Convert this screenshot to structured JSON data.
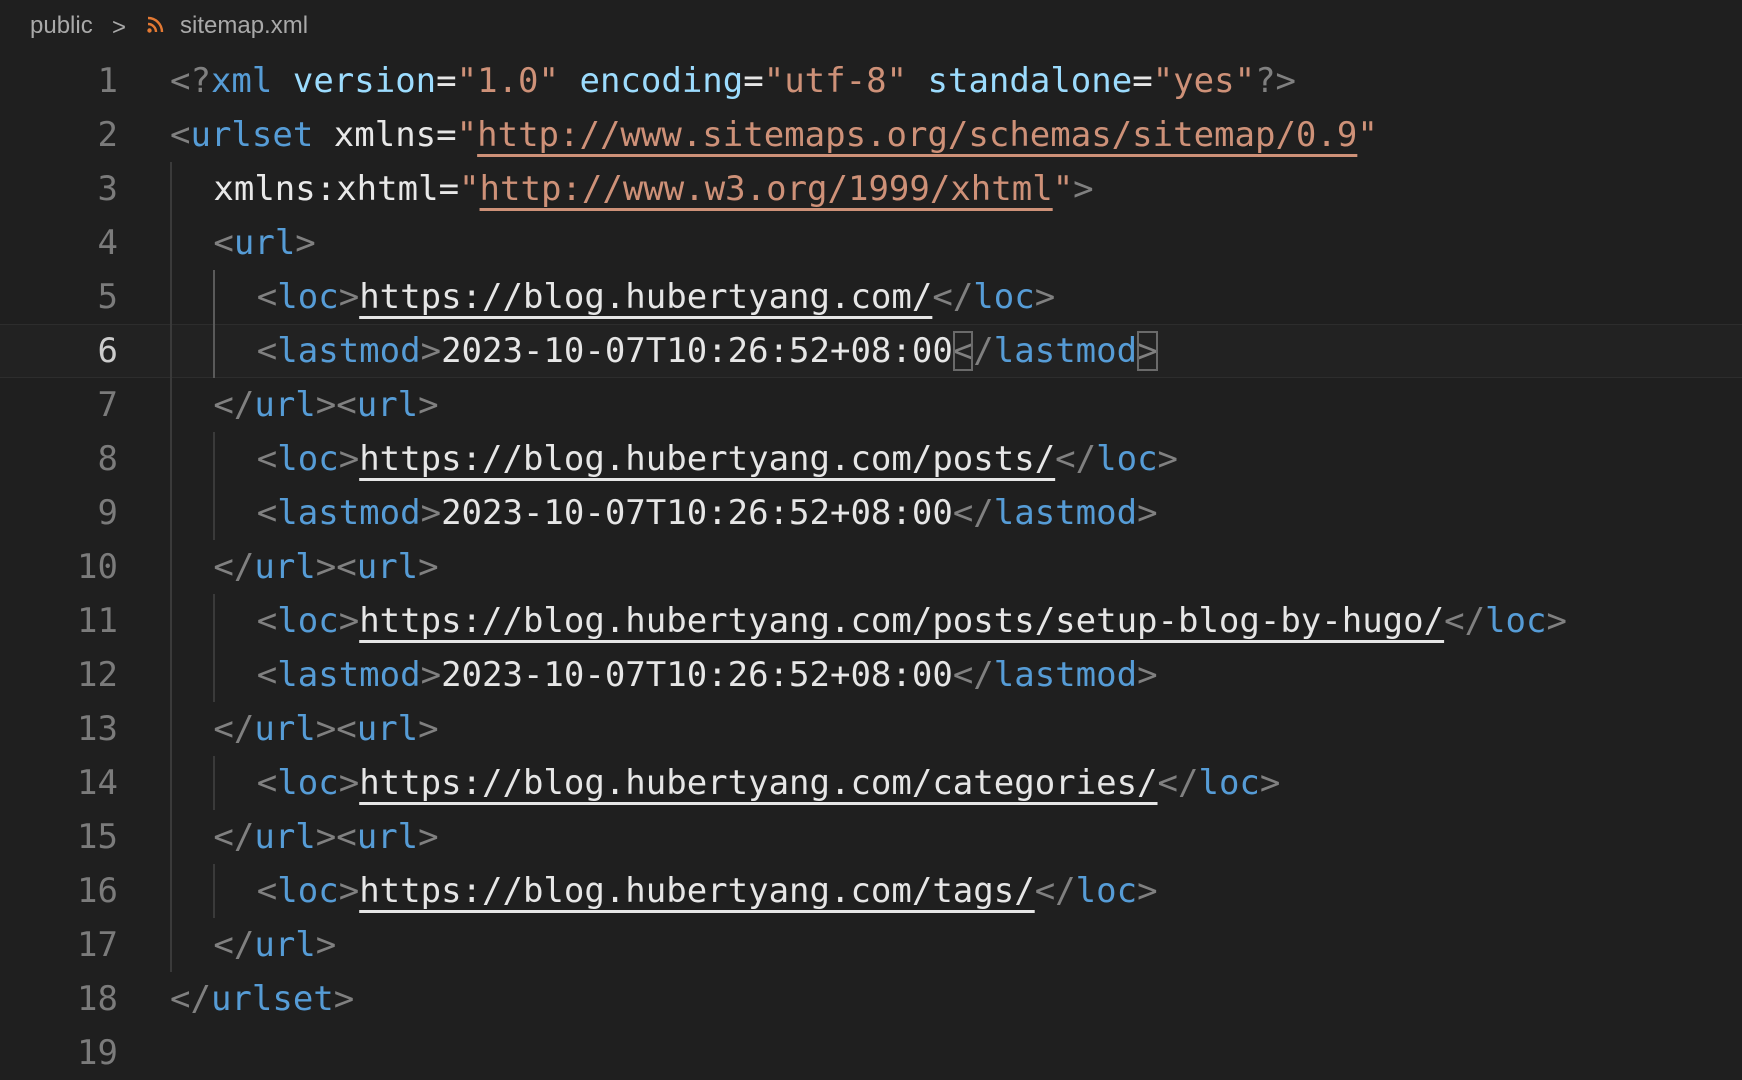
{
  "breadcrumb": {
    "folder": "public",
    "separator": ">",
    "file": "sitemap.xml",
    "file_icon": "rss-icon"
  },
  "colors": {
    "background": "#1f1f1f",
    "tag": "#569cd6",
    "attribute": "#9cdcfe",
    "string": "#ce9178",
    "punctuation": "#808080",
    "text": "#e6e6e6",
    "line_number": "#7b7b7b",
    "icon": "#e37933"
  },
  "editor": {
    "current_line": 6,
    "lines": [
      {
        "n": "1",
        "indent": 0,
        "tokens": [
          {
            "t": "<?",
            "c": "punct"
          },
          {
            "t": "xml",
            "c": "tag"
          },
          {
            "t": " ",
            "c": "text"
          },
          {
            "t": "version",
            "c": "attr"
          },
          {
            "t": "=",
            "c": "text"
          },
          {
            "t": "\"1.0\"",
            "c": "str"
          },
          {
            "t": " ",
            "c": "text"
          },
          {
            "t": "encoding",
            "c": "attr"
          },
          {
            "t": "=",
            "c": "text"
          },
          {
            "t": "\"utf-8\"",
            "c": "str"
          },
          {
            "t": " ",
            "c": "text"
          },
          {
            "t": "standalone",
            "c": "attr"
          },
          {
            "t": "=",
            "c": "text"
          },
          {
            "t": "\"yes\"",
            "c": "str"
          },
          {
            "t": "?>",
            "c": "punct"
          }
        ]
      },
      {
        "n": "2",
        "indent": 0,
        "tokens": [
          {
            "t": "<",
            "c": "punct"
          },
          {
            "t": "urlset",
            "c": "tag"
          },
          {
            "t": " ",
            "c": "text"
          },
          {
            "t": "xmlns",
            "c": "attr2"
          },
          {
            "t": "=",
            "c": "text"
          },
          {
            "t": "\"",
            "c": "str"
          },
          {
            "t": "http://www.sitemaps.org/schemas/sitemap/0.9",
            "c": "link"
          },
          {
            "t": "\"",
            "c": "str"
          }
        ]
      },
      {
        "n": "3",
        "indent": 1,
        "tokens": [
          {
            "t": "xmlns:xhtml",
            "c": "attr2"
          },
          {
            "t": "=",
            "c": "text"
          },
          {
            "t": "\"",
            "c": "str"
          },
          {
            "t": "http://www.w3.org/1999/xhtml",
            "c": "link"
          },
          {
            "t": "\"",
            "c": "str"
          },
          {
            "t": ">",
            "c": "punct"
          }
        ]
      },
      {
        "n": "4",
        "indent": 1,
        "tokens": [
          {
            "t": "<",
            "c": "punct"
          },
          {
            "t": "url",
            "c": "tag"
          },
          {
            "t": ">",
            "c": "punct"
          }
        ]
      },
      {
        "n": "5",
        "indent": 2,
        "tokens": [
          {
            "t": "<",
            "c": "punct"
          },
          {
            "t": "loc",
            "c": "tag"
          },
          {
            "t": ">",
            "c": "punct"
          },
          {
            "t": "https://blog.hubertyang.com/",
            "c": "textlink"
          },
          {
            "t": "</",
            "c": "punct"
          },
          {
            "t": "loc",
            "c": "tag"
          },
          {
            "t": ">",
            "c": "punct"
          }
        ]
      },
      {
        "n": "6",
        "indent": 2,
        "tokens": [
          {
            "t": "<",
            "c": "punct"
          },
          {
            "t": "lastmod",
            "c": "tag"
          },
          {
            "t": ">",
            "c": "punct"
          },
          {
            "t": "2023-10-07T10:26:52+08:00",
            "c": "text"
          },
          {
            "t": "<",
            "c": "punct",
            "m": true
          },
          {
            "t": "/",
            "c": "punct"
          },
          {
            "t": "lastmod",
            "c": "tag"
          },
          {
            "t": ">",
            "c": "punct",
            "m": true
          }
        ]
      },
      {
        "n": "7",
        "indent": 1,
        "tokens": [
          {
            "t": "</",
            "c": "punct"
          },
          {
            "t": "url",
            "c": "tag"
          },
          {
            "t": "><",
            "c": "punct"
          },
          {
            "t": "url",
            "c": "tag"
          },
          {
            "t": ">",
            "c": "punct"
          }
        ]
      },
      {
        "n": "8",
        "indent": 2,
        "tokens": [
          {
            "t": "<",
            "c": "punct"
          },
          {
            "t": "loc",
            "c": "tag"
          },
          {
            "t": ">",
            "c": "punct"
          },
          {
            "t": "https://blog.hubertyang.com/posts/",
            "c": "textlink"
          },
          {
            "t": "</",
            "c": "punct"
          },
          {
            "t": "loc",
            "c": "tag"
          },
          {
            "t": ">",
            "c": "punct"
          }
        ]
      },
      {
        "n": "9",
        "indent": 2,
        "tokens": [
          {
            "t": "<",
            "c": "punct"
          },
          {
            "t": "lastmod",
            "c": "tag"
          },
          {
            "t": ">",
            "c": "punct"
          },
          {
            "t": "2023-10-07T10:26:52+08:00",
            "c": "text"
          },
          {
            "t": "</",
            "c": "punct"
          },
          {
            "t": "lastmod",
            "c": "tag"
          },
          {
            "t": ">",
            "c": "punct"
          }
        ]
      },
      {
        "n": "10",
        "indent": 1,
        "tokens": [
          {
            "t": "</",
            "c": "punct"
          },
          {
            "t": "url",
            "c": "tag"
          },
          {
            "t": "><",
            "c": "punct"
          },
          {
            "t": "url",
            "c": "tag"
          },
          {
            "t": ">",
            "c": "punct"
          }
        ]
      },
      {
        "n": "11",
        "indent": 2,
        "tokens": [
          {
            "t": "<",
            "c": "punct"
          },
          {
            "t": "loc",
            "c": "tag"
          },
          {
            "t": ">",
            "c": "punct"
          },
          {
            "t": "https://blog.hubertyang.com/posts/setup-blog-by-hugo/",
            "c": "textlink"
          },
          {
            "t": "</",
            "c": "punct"
          },
          {
            "t": "loc",
            "c": "tag"
          },
          {
            "t": ">",
            "c": "punct"
          }
        ]
      },
      {
        "n": "12",
        "indent": 2,
        "tokens": [
          {
            "t": "<",
            "c": "punct"
          },
          {
            "t": "lastmod",
            "c": "tag"
          },
          {
            "t": ">",
            "c": "punct"
          },
          {
            "t": "2023-10-07T10:26:52+08:00",
            "c": "text"
          },
          {
            "t": "</",
            "c": "punct"
          },
          {
            "t": "lastmod",
            "c": "tag"
          },
          {
            "t": ">",
            "c": "punct"
          }
        ]
      },
      {
        "n": "13",
        "indent": 1,
        "tokens": [
          {
            "t": "</",
            "c": "punct"
          },
          {
            "t": "url",
            "c": "tag"
          },
          {
            "t": "><",
            "c": "punct"
          },
          {
            "t": "url",
            "c": "tag"
          },
          {
            "t": ">",
            "c": "punct"
          }
        ]
      },
      {
        "n": "14",
        "indent": 2,
        "tokens": [
          {
            "t": "<",
            "c": "punct"
          },
          {
            "t": "loc",
            "c": "tag"
          },
          {
            "t": ">",
            "c": "punct"
          },
          {
            "t": "https://blog.hubertyang.com/categories/",
            "c": "textlink"
          },
          {
            "t": "</",
            "c": "punct"
          },
          {
            "t": "loc",
            "c": "tag"
          },
          {
            "t": ">",
            "c": "punct"
          }
        ]
      },
      {
        "n": "15",
        "indent": 1,
        "tokens": [
          {
            "t": "</",
            "c": "punct"
          },
          {
            "t": "url",
            "c": "tag"
          },
          {
            "t": "><",
            "c": "punct"
          },
          {
            "t": "url",
            "c": "tag"
          },
          {
            "t": ">",
            "c": "punct"
          }
        ]
      },
      {
        "n": "16",
        "indent": 2,
        "tokens": [
          {
            "t": "<",
            "c": "punct"
          },
          {
            "t": "loc",
            "c": "tag"
          },
          {
            "t": ">",
            "c": "punct"
          },
          {
            "t": "https://blog.hubertyang.com/tags/",
            "c": "textlink"
          },
          {
            "t": "</",
            "c": "punct"
          },
          {
            "t": "loc",
            "c": "tag"
          },
          {
            "t": ">",
            "c": "punct"
          }
        ]
      },
      {
        "n": "17",
        "indent": 1,
        "tokens": [
          {
            "t": "</",
            "c": "punct"
          },
          {
            "t": "url",
            "c": "tag"
          },
          {
            "t": ">",
            "c": "punct"
          }
        ]
      },
      {
        "n": "18",
        "indent": 0,
        "tokens": [
          {
            "t": "</",
            "c": "punct"
          },
          {
            "t": "urlset",
            "c": "tag"
          },
          {
            "t": ">",
            "c": "punct"
          }
        ]
      },
      {
        "n": "19",
        "indent": 0,
        "tokens": []
      }
    ]
  }
}
